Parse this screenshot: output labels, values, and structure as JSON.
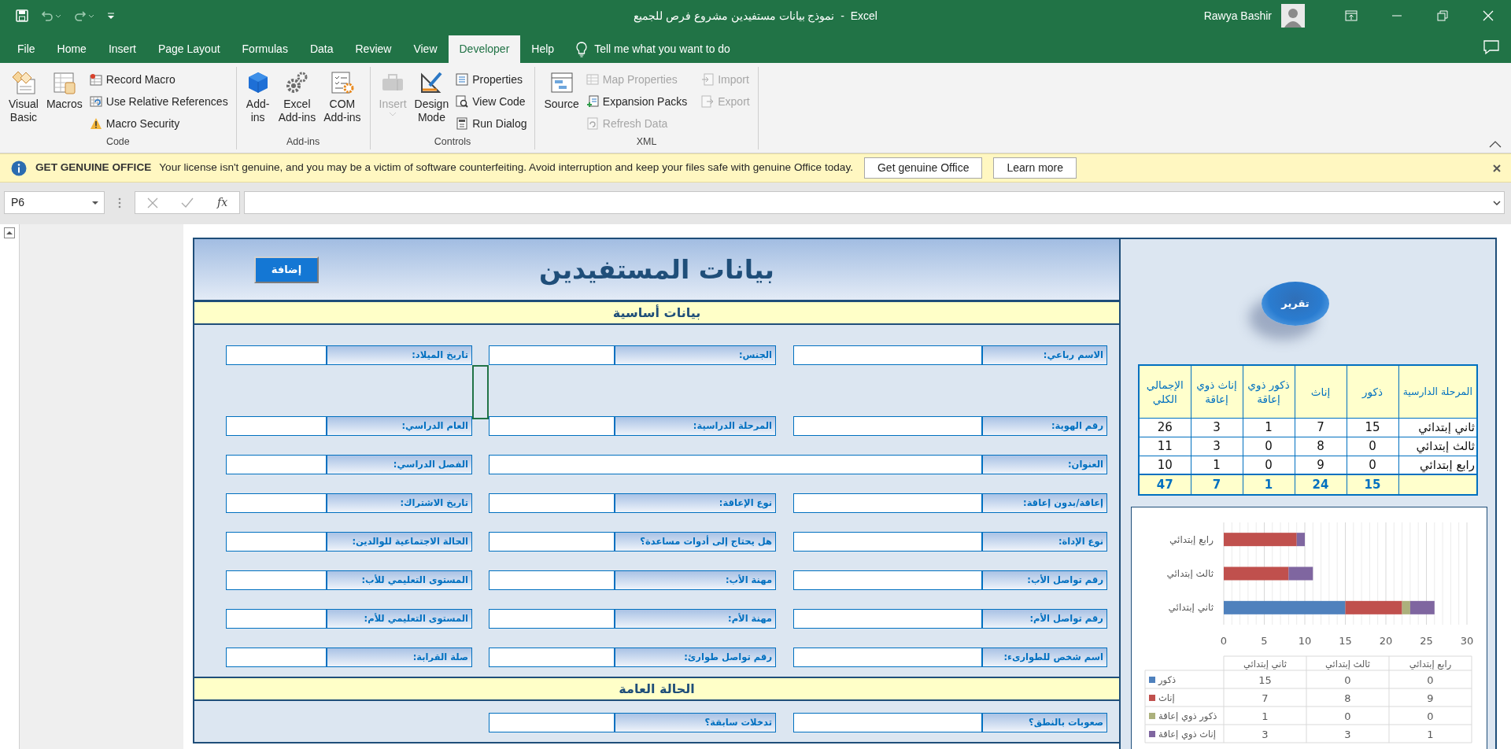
{
  "title_bar": {
    "document_title": "نموذج بيانات مستفيدين مشروع فرص للجميع  -  Excel",
    "user": "Rawya Bashir"
  },
  "ribbon_tabs": [
    {
      "label": "Help",
      "selected": false
    },
    {
      "label": "Developer",
      "selected": true
    },
    {
      "label": "View",
      "selected": false
    },
    {
      "label": "Review",
      "selected": false
    },
    {
      "label": "Data",
      "selected": false
    },
    {
      "label": "Formulas",
      "selected": false
    },
    {
      "label": "Page Layout",
      "selected": false
    },
    {
      "label": "Insert",
      "selected": false
    },
    {
      "label": "Home",
      "selected": false
    },
    {
      "label": "File",
      "selected": false
    }
  ],
  "tell_me": "Tell me what you want to do",
  "ribbon": {
    "groups": [
      {
        "label": "XML",
        "large": [
          {
            "label": "Source",
            "disabled": false,
            "menu": false
          }
        ],
        "small": [
          {
            "label": "Import",
            "disabled": true
          },
          {
            "label": "Export",
            "disabled": true
          },
          {
            "label": "Map Properties",
            "disabled": true
          },
          {
            "label": "Expansion Packs",
            "disabled": false
          },
          {
            "label": "Refresh Data",
            "disabled": true
          }
        ]
      },
      {
        "label": "Controls",
        "large": [
          {
            "label": "Design\nMode",
            "disabled": false,
            "menu": false
          },
          {
            "label": "Insert",
            "disabled": true,
            "menu": true
          }
        ],
        "small": [
          {
            "label": "Properties",
            "disabled": false
          },
          {
            "label": "View Code",
            "disabled": false
          },
          {
            "label": "Run Dialog",
            "disabled": false
          }
        ]
      },
      {
        "label": "Add-ins",
        "large": [
          {
            "label": "COM\nAdd-ins",
            "disabled": false,
            "menu": false
          },
          {
            "label": "Excel\nAdd-ins",
            "disabled": false,
            "menu": false
          },
          {
            "label": "Add-\nins",
            "disabled": false,
            "menu": false
          }
        ]
      },
      {
        "label": "Code",
        "large": [
          {
            "label": "Macros",
            "disabled": false,
            "menu": false
          },
          {
            "label": "Visual\nBasic",
            "disabled": false,
            "menu": false
          }
        ],
        "small": [
          {
            "label": "Record Macro",
            "disabled": false
          },
          {
            "label": "Use Relative References",
            "disabled": false
          },
          {
            "label": "Macro Security",
            "disabled": false
          }
        ]
      }
    ]
  },
  "message_bar": {
    "title": "GET GENUINE OFFICE",
    "message": "Your license isn't genuine, and you may be a victim of software counterfeiting. Avoid interruption and keep your files safe with genuine Office today.",
    "buttons": [
      "Learn more",
      "Get genuine Office"
    ]
  },
  "formula_bar": {
    "name_box": "P6",
    "function_label": "fx"
  },
  "form": {
    "title": "بيانات المستفيدين",
    "add_button": "إضافة",
    "sections": [
      {
        "title": "بيانات أساسية",
        "rows": [
          {
            "kind": "fields",
            "fields": [
              {
                "label": "الاسم رباعي:",
                "kind": "normal"
              },
              {
                "label": "الجنس:",
                "kind": "normal"
              },
              {
                "label": "تاريخ الميلاد:",
                "kind": "normal"
              }
            ]
          },
          {
            "kind": "gap",
            "cursor": true
          },
          {
            "kind": "fields",
            "fields": [
              {
                "label": "رقم الهوية:",
                "kind": "normal"
              },
              {
                "label": "المرحلة الدراسية:",
                "kind": "normal"
              },
              {
                "label": "العام الدراسي:",
                "kind": "normal"
              }
            ]
          },
          {
            "kind": "fields",
            "fields": [
              {
                "label": "العنوان:",
                "kind": "wide"
              },
              {
                "label": "الفصل الدراسي:",
                "kind": "normal"
              }
            ]
          },
          {
            "kind": "fields",
            "fields": [
              {
                "label": "إعاقة/بدون إعاقة:",
                "kind": "normal"
              },
              {
                "label": "نوع الإعاقة:",
                "kind": "normal"
              },
              {
                "label": "تاريخ الاشتراك:",
                "kind": "normal"
              }
            ]
          },
          {
            "kind": "fields",
            "fields": [
              {
                "label": "نوع الإداة:",
                "kind": "normal"
              },
              {
                "label": "هل يحتاج إلى أدوات مساعدة؟",
                "kind": "normal"
              },
              {
                "label": "الحالة الاجتماعية للوالدين:",
                "kind": "normal"
              }
            ]
          },
          {
            "kind": "fields",
            "fields": [
              {
                "label": "رقم تواصل الأب:",
                "kind": "normal"
              },
              {
                "label": "مهنة الأب:",
                "kind": "normal"
              },
              {
                "label": "المستوى التعليمي للأب:",
                "kind": "normal"
              }
            ]
          },
          {
            "kind": "fields",
            "fields": [
              {
                "label": "رقم تواصل الأم:",
                "kind": "normal"
              },
              {
                "label": "مهنة الأم:",
                "kind": "normal"
              },
              {
                "label": "المستوى التعليمي للأم:",
                "kind": "normal"
              }
            ]
          },
          {
            "kind": "fields",
            "fields": [
              {
                "label": "اسم شخص للطوارىء:",
                "kind": "normal"
              },
              {
                "label": "رقم تواصل طوارئ:",
                "kind": "normal"
              },
              {
                "label": "صلة القرابة:",
                "kind": "normal"
              }
            ]
          }
        ]
      },
      {
        "title": "الحالة العامة",
        "rows": [
          {
            "kind": "fields",
            "fields": [
              {
                "label": "صعوبات بالنطق؟",
                "kind": "normal"
              },
              {
                "label": "تدخلات سابقة؟",
                "kind": "normal"
              }
            ]
          }
        ]
      }
    ]
  },
  "side_panel": {
    "report_button": "تقرير",
    "summary_table": {
      "columns": [
        "المرحلة الدارسية",
        "ذكور",
        "إناث",
        "ذكور ذوي إعاقة",
        "إناث ذوي إعاقة",
        "الإجمالي الكلي"
      ],
      "rows": [
        {
          "cells": [
            "ثاني إبتدائي",
            "15",
            "7",
            "1",
            "3",
            "26"
          ]
        },
        {
          "cells": [
            "ثالث إبتدائي",
            "0",
            "8",
            "0",
            "3",
            "11"
          ]
        },
        {
          "cells": [
            "رابع إبتدائي",
            "0",
            "9",
            "0",
            "1",
            "10"
          ]
        }
      ],
      "totals": [
        "15",
        "24",
        "1",
        "7",
        "47"
      ]
    },
    "chart": {
      "chart_data": {
        "type": "bar",
        "orientation": "horizontal",
        "stacked": true,
        "grid": true,
        "legend": true,
        "categories": [
          "رابع إبتدائي",
          "ثالث إبتدائي",
          "ثاني إبتدائي"
        ],
        "series": [
          {
            "name": "ذكور",
            "color": "#4f81bd",
            "values": [
              0,
              0,
              15
            ]
          },
          {
            "name": "إناث",
            "color": "#c0504d",
            "values": [
              9,
              8,
              7
            ]
          },
          {
            "name": "ذكور ذوي إعاقة",
            "color": "#acb17c",
            "values": [
              0,
              0,
              1
            ]
          },
          {
            "name": "إناث ذوي إعاقة",
            "color": "#7f66a0",
            "values": [
              1,
              3,
              3
            ]
          }
        ],
        "xlim": [
          0,
          30
        ],
        "xticks": [
          0,
          5,
          10,
          15,
          20,
          25,
          30
        ]
      },
      "data_table": {
        "columns": [
          "رابع إبتدائي",
          "ثالث إبتدائي",
          "ثاني إبتدائي"
        ],
        "rows": [
          {
            "cells": [
              "0",
              "0",
              "15"
            ]
          },
          {
            "cells": [
              "9",
              "8",
              "7"
            ]
          },
          {
            "cells": [
              "0",
              "0",
              "1"
            ]
          },
          {
            "cells": [
              "1",
              "3",
              "3"
            ]
          }
        ]
      }
    }
  }
}
